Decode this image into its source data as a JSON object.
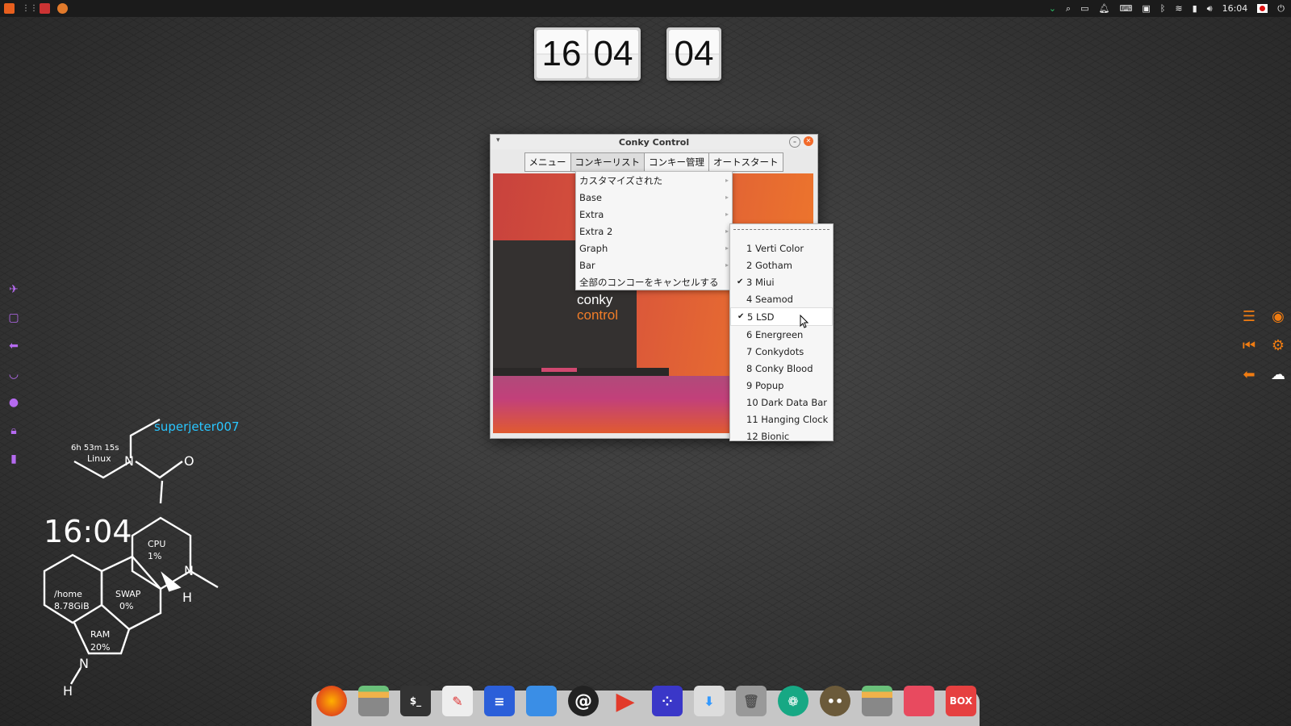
{
  "top_panel": {
    "left_icons": [
      "ubuntu-logo-icon",
      "apps-grid-icon",
      "calendar-app-icon",
      "firefox-icon"
    ],
    "right_icons": [
      "chevron-down-icon",
      "search-icon",
      "window-icon",
      "bell-icon",
      "keyboard-icon",
      "screenshot-icon",
      "bluetooth-icon",
      "wifi-icon",
      "battery-icon",
      "volume-icon"
    ],
    "time": "16:04",
    "user_icon": "user-flag-icon"
  },
  "flip_clock": {
    "hours": "16",
    "minutes": "04",
    "seconds": "04"
  },
  "window": {
    "title": "Conky Control",
    "menu": [
      "メニュー",
      "コンキーリスト",
      "コンキー管理",
      "オートスタート"
    ],
    "active_menu_index": 1,
    "brand_line1": "conky",
    "brand_line2": "control"
  },
  "menu_list": [
    {
      "label": "カスタマイズされた",
      "submenu": true
    },
    {
      "label": "Base",
      "submenu": true
    },
    {
      "label": "Extra",
      "submenu": true
    },
    {
      "label": "Extra 2",
      "submenu": true
    },
    {
      "label": "Graph",
      "submenu": true
    },
    {
      "label": "Bar",
      "submenu": true
    },
    {
      "label": "全部のコンコーをキャンセルする",
      "submenu": false
    }
  ],
  "submenu": [
    {
      "label": "1 Verti Color",
      "checked": false
    },
    {
      "label": "2 Gotham",
      "checked": false
    },
    {
      "label": "3 Miui",
      "checked": true
    },
    {
      "label": "4 Seamod",
      "checked": false
    },
    {
      "label": "5 LSD",
      "checked": true
    },
    {
      "label": "6 Energreen",
      "checked": false
    },
    {
      "label": "7 Conkydots",
      "checked": false
    },
    {
      "label": "8 Conky Blood",
      "checked": false
    },
    {
      "label": "9 Popup",
      "checked": false
    },
    {
      "label": "10 Dark Data Bar",
      "checked": false
    },
    {
      "label": "11 Hanging Clock",
      "checked": false
    },
    {
      "label": "12 Bionic",
      "checked": false
    }
  ],
  "conky": {
    "username": "superjeter007",
    "uptime": "6h 53m 15s",
    "os": "Linux",
    "time": "16:04",
    "cpu_label": "CPU",
    "cpu_value": "1%",
    "home_label": "/home",
    "home_value": "8.78GiB",
    "swap_label": "SWAP",
    "swap_value": "0%",
    "ram_label": "RAM",
    "ram_value": "20%",
    "atom_n": "N",
    "atom_o": "O",
    "atom_h": "H"
  },
  "left_sidebar_icons": [
    "airplane-icon",
    "monitor-icon",
    "arrow-left-icon",
    "mask-icon",
    "globe-icon",
    "lock-icon",
    "chart-icon"
  ],
  "right_widget_icons": [
    "menu-icon",
    "eye-icon",
    "skip-back-icon",
    "gear-icon",
    "arrow-left-icon",
    "weather-cloud-icon"
  ],
  "dock_icons": [
    "firefox-icon",
    "files-icon",
    "terminal-icon",
    "text-editor-icon",
    "document-icon",
    "window-icon",
    "email-icon",
    "media-player-icon",
    "dots-app-icon",
    "package-icon",
    "trash-icon",
    "aperture-icon",
    "gimp-icon",
    "files2-icon",
    "photos-icon",
    "box-icon"
  ],
  "dock_box_label": "BOX",
  "colors": {
    "accent": "#f07c12",
    "conky_user": "#29c6ff",
    "sidebar_purple": "#b56af0"
  }
}
